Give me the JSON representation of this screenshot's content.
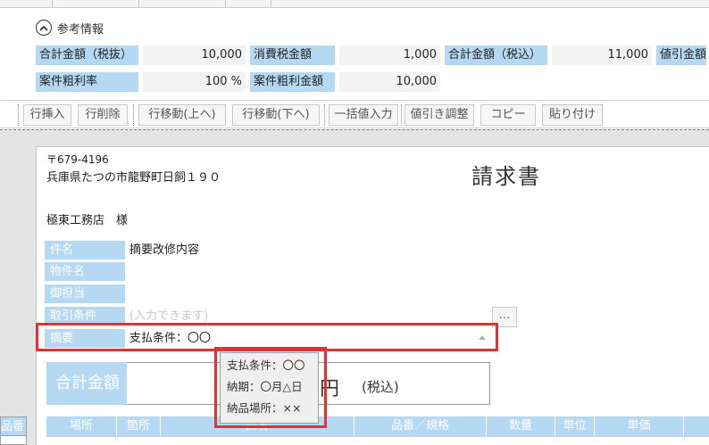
{
  "reference": {
    "title": "参考情報",
    "row1": [
      {
        "label": "合計金額（税抜）",
        "value": "10,000"
      },
      {
        "label": "消費税金額",
        "value": "1,000"
      },
      {
        "label": "合計金額（税込）",
        "value": "11,000"
      },
      {
        "label": "値引金額",
        "value": ""
      }
    ],
    "row2": [
      {
        "label": "案件粗利率",
        "value": "100 %"
      },
      {
        "label": "案件粗利金額",
        "value": "10,000"
      }
    ]
  },
  "toolbar": {
    "buttons": [
      "行挿入",
      "行削除",
      "行移動(上へ)",
      "行移動(下へ)",
      "一括値入力",
      "値引き調整",
      "コピー",
      "貼り付け"
    ]
  },
  "invoice": {
    "postal_code": "〒679-4196",
    "address": "兵庫県たつの市龍野町日飼１９０",
    "title": "請求書",
    "customer": "極東工務店　様",
    "fields": [
      {
        "label": "件名",
        "value": "摘要改修内容",
        "placeholder": ""
      },
      {
        "label": "物件名",
        "value": "",
        "placeholder": ""
      },
      {
        "label": "御担当",
        "value": "",
        "placeholder": ""
      },
      {
        "label": "取引条件",
        "value": "",
        "placeholder": "(入力できます)"
      },
      {
        "label": "摘要",
        "value": "支払条件：〇〇",
        "placeholder": ""
      }
    ],
    "more_button": "…",
    "total_label": "合計金額",
    "yen": "円",
    "tax_included": "(税込)"
  },
  "tooltip": {
    "lines": [
      "支払条件：〇〇",
      "納期：〇月△日",
      "納品場所：××"
    ]
  },
  "grid": {
    "left_tab": "品番",
    "columns": [
      "場所",
      "箇所",
      "品名",
      "品番／規格",
      "数量",
      "単位",
      "単価",
      ""
    ]
  },
  "colors": {
    "label_bg": "#b5d9f3",
    "highlight": "#e53030"
  }
}
